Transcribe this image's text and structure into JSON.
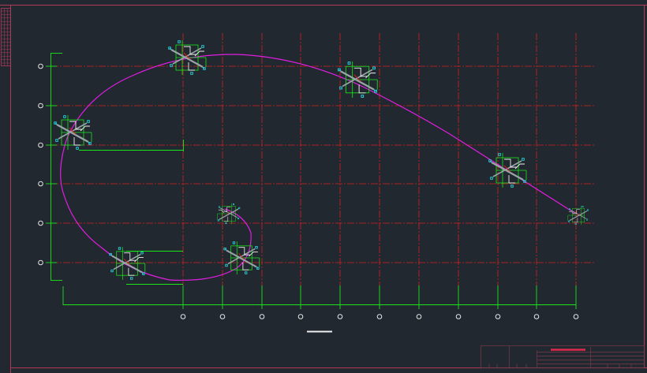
{
  "drawing": {
    "colors": {
      "background": "#212830",
      "frame": "#b03a5a",
      "grid_line": "#d42020",
      "dimension": "#19e619",
      "curve": "#e01ee0",
      "bubble": "#e6e6e6",
      "detail_cyan": "#29d6e0",
      "detail_white": "#f0f0f0",
      "detail_gray": "#9aa3a8",
      "title_line": "#7a3a48",
      "title_highlight": "#e0284a"
    },
    "icons": {
      "grid_bubble": "circle",
      "curved_path": "magenta-spline",
      "detail_block": "cad-symbol"
    },
    "grid": {
      "vertical_axis_count": 11,
      "horizontal_axis_count": 6
    },
    "detail_block_count": 8
  }
}
